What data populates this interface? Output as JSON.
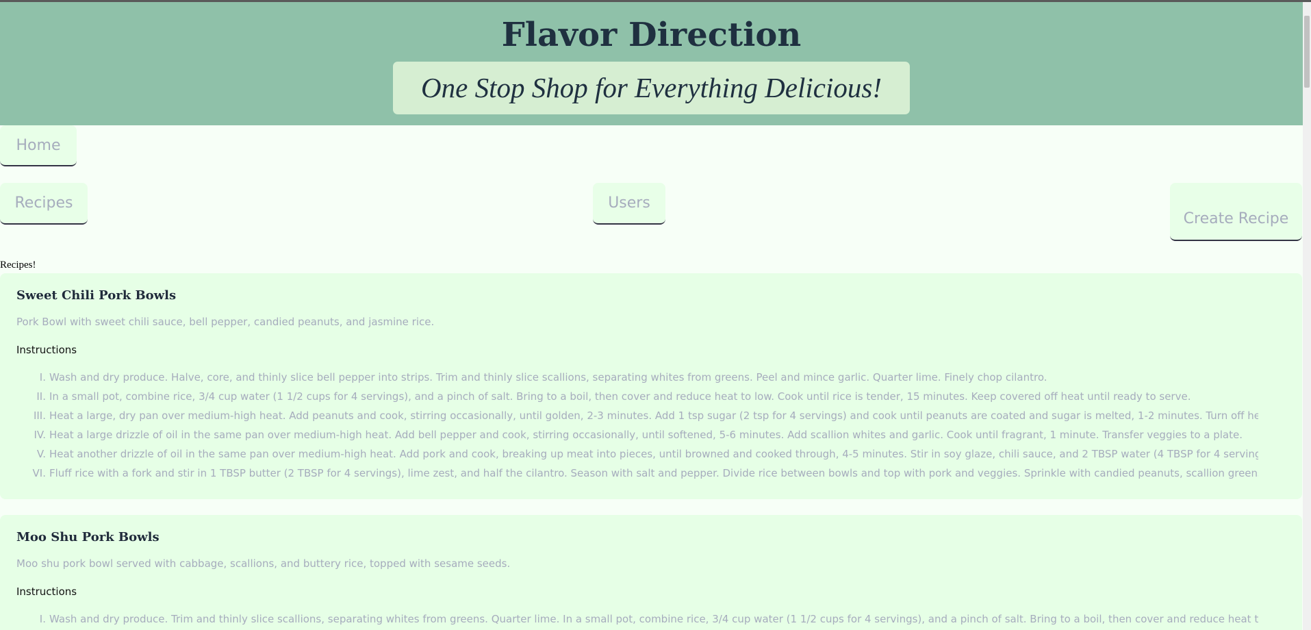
{
  "header": {
    "title": "Flavor Direction",
    "subtitle": "One Stop Shop for Everything Delicious!"
  },
  "nav": {
    "home": "Home",
    "recipes": "Recipes",
    "users": "Users",
    "create": "Create Recipe"
  },
  "section_label": "Recipes!",
  "recipes": [
    {
      "title": "Sweet Chili Pork Bowls",
      "description": "Pork Bowl with sweet chili sauce, bell pepper, candied peanuts, and jasmine rice.",
      "instructions_label": "Instructions",
      "steps": [
        {
          "n": "I.",
          "text": "Wash and dry produce. Halve, core, and thinly slice bell pepper into strips. Trim and thinly slice scallions, separating whites from greens. Peel and mince garlic. Quarter lime. Finely chop cilantro."
        },
        {
          "n": "II.",
          "text": "In a small pot, combine rice, 3/4 cup water (1 1/2 cups for 4 servings), and a pinch of salt. Bring to a boil, then cover and reduce heat to low. Cook until rice is tender, 15 minutes. Keep covered off heat until ready to serve."
        },
        {
          "n": "III.",
          "text": "Heat a large, dry pan over medium-high heat. Add peanuts and cook, stirring occasionally, until golden, 2-3 minutes. Add 1 tsp sugar (2 tsp for 4 servings) and cook until peanuts are coated and sugar is melted, 1-2 minutes. Turn off heat and transfer to a"
        },
        {
          "n": "IV.",
          "text": "Heat a large drizzle of oil in the same pan over medium-high heat. Add bell pepper and cook, stirring occasionally, until softened, 5-6 minutes. Add scallion whites and garlic. Cook until fragrant, 1 minute. Transfer veggies to a plate."
        },
        {
          "n": "V.",
          "text": "Heat another drizzle of oil in the same pan over medium-high heat. Add pork and cook, breaking up meat into pieces, until browned and cooked through, 4-5 minutes. Stir in soy glaze, chili sauce, and 2 TBSP water (4 TBSP for 4 servings). Cook until sauce i"
        },
        {
          "n": "VI.",
          "text": "Fluff rice with a fork and stir in 1 TBSP butter (2 TBSP for 4 servings), lime zest, and half the cilantro. Season with salt and pepper. Divide rice between bowls and top with pork and veggies. Sprinkle with candied peanuts, scallion greens, and remaining"
        }
      ]
    },
    {
      "title": "Moo Shu Pork Bowls",
      "description": "Moo shu pork bowl served with cabbage, scallions, and buttery rice, topped with sesame seeds.",
      "instructions_label": "Instructions",
      "steps": [
        {
          "n": "I.",
          "text": "Wash and dry produce. Trim and thinly slice scallions, separating whites from greens. Quarter lime. In a small pot, combine rice, 3/4 cup water (1 1/2 cups for 4 servings), and a pinch of salt. Bring to a boil, then cover and reduce heat to low. Cook unti"
        }
      ]
    }
  ],
  "colors": {
    "header_bg": "#8fc1a9",
    "subtitle_bg": "#d6eed2",
    "card_bg": "#e6ffe6",
    "page_bg": "#f7fff7",
    "muted_text": "#a6acbd",
    "title_text": "#1f3040"
  }
}
